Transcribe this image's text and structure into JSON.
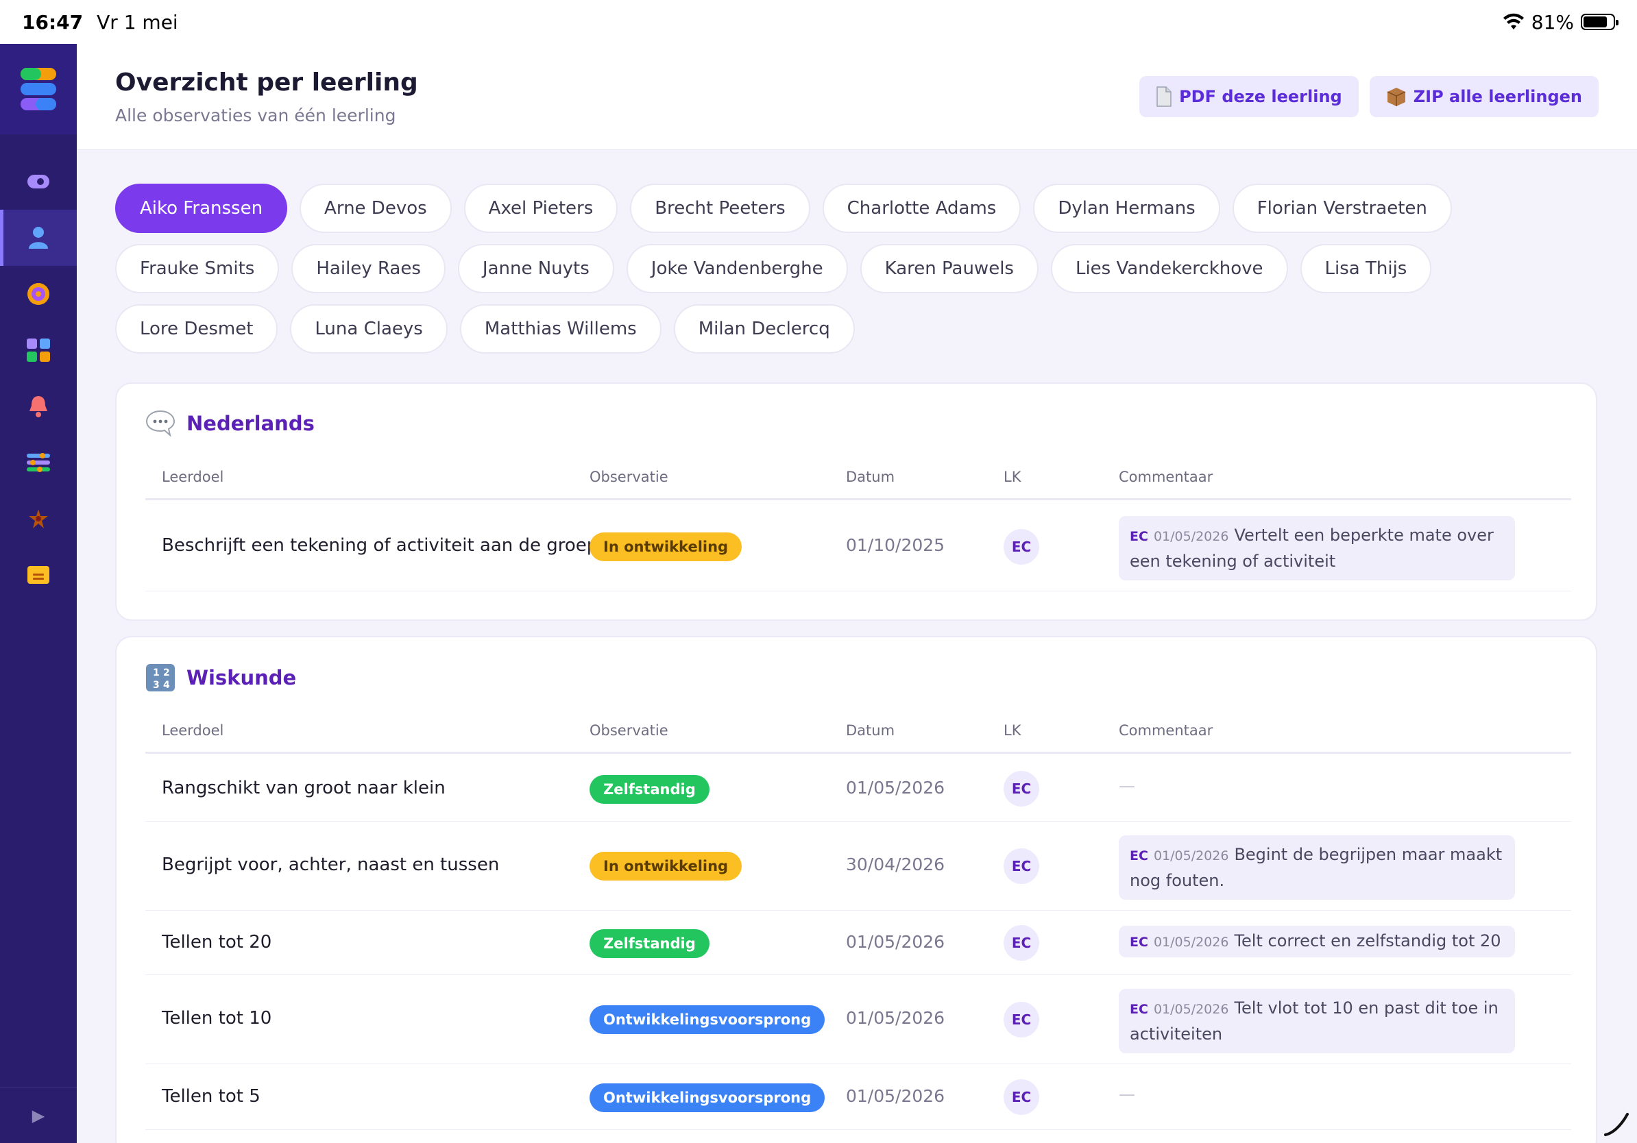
{
  "status": {
    "time": "16:47",
    "date": "Vr 1 mei",
    "battery": "81%"
  },
  "header": {
    "title": "Overzicht per leerling",
    "subtitle": "Alle observaties van één leerling",
    "pdf_label": "PDF deze leerling",
    "zip_label": "ZIP alle leerlingen"
  },
  "students": [
    "Aiko Franssen",
    "Arne Devos",
    "Axel Pieters",
    "Brecht Peeters",
    "Charlotte Adams",
    "Dylan Hermans",
    "Florian Verstraeten",
    "Frauke Smits",
    "Hailey Raes",
    "Janne Nuyts",
    "Joke Vandenberghe",
    "Karen Pauwels",
    "Lies Vandekerckhove",
    "Lisa Thijs",
    "Lore Desmet",
    "Luna Claeys",
    "Matthias Willems",
    "Milan Declercq"
  ],
  "columns": {
    "goal": "Leerdoel",
    "obs": "Observatie",
    "date": "Datum",
    "lk": "LK",
    "comment": "Commentaar"
  },
  "subjects": [
    {
      "title": "Nederlands",
      "rows": [
        {
          "goal": "Beschrijft een tekening of activiteit aan de groep",
          "obs": "In ontwikkeling",
          "date": "01/10/2025",
          "lk": "EC",
          "comment_ini": "EC",
          "comment_date": "01/05/2026",
          "comment": "Vertelt een beperkte mate over een tekening of activiteit"
        }
      ]
    },
    {
      "title": "Wiskunde",
      "rows": [
        {
          "goal": "Rangschikt van groot naar klein",
          "obs": "Zelfstandig",
          "date": "01/05/2026",
          "lk": "EC",
          "dash": "—"
        },
        {
          "goal": "Begrijpt voor, achter, naast en tussen",
          "obs": "In ontwikkeling",
          "date": "30/04/2026",
          "lk": "EC",
          "comment_ini": "EC",
          "comment_date": "01/05/2026",
          "comment": "Begint de begrijpen maar maakt nog fouten."
        },
        {
          "goal": "Tellen tot 20",
          "obs": "Zelfstandig",
          "date": "01/05/2026",
          "lk": "EC",
          "comment_ini": "EC",
          "comment_date": "01/05/2026",
          "comment": "Telt correct en zelfstandig tot 20"
        },
        {
          "goal": "Tellen tot 10",
          "obs": "Ontwikkelingsvoorsprong",
          "date": "01/05/2026",
          "lk": "EC",
          "comment_ini": "EC",
          "comment_date": "01/05/2026",
          "comment": "Telt vlot tot 10 en past dit toe in activiteiten"
        },
        {
          "goal": "Tellen tot 5",
          "obs": "Ontwikkelingsvoorsprong",
          "date": "01/05/2026",
          "lk": "EC",
          "dash": "—"
        }
      ]
    }
  ],
  "colors": {
    "accent": "#7c3aed",
    "sidebar": "#2a1d6e",
    "in_ontwikkeling": "#fbbf24",
    "zelfstandig": "#22c55e",
    "voorsprong": "#3b82f6"
  },
  "icons": [
    "gauge-icon",
    "user-icon",
    "target-icon",
    "grid-icon",
    "bell-icon",
    "sliders-icon",
    "star-icon",
    "note-icon",
    "expand-icon"
  ]
}
